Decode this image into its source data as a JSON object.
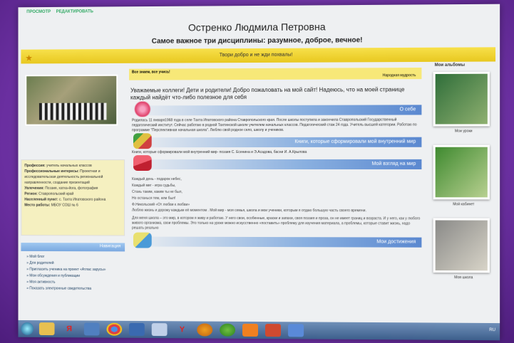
{
  "nav": {
    "items": [
      "ПРОСМОТР",
      "РЕДАКТИРОВАТЬ"
    ]
  },
  "site": {
    "title": "Остренко Людмила Петровна",
    "subtitle": "Самое важное три дисциплины: разумное, доброе, вечное!",
    "banner": "Твори добро и не жди похвалы!"
  },
  "quote": {
    "text": "Все знаем, все учись!",
    "source": "Народная мудрость"
  },
  "welcome": "Уважаемые коллеги! Дети и родители! Добро пожаловать на мой сайт! Надеюсь, что на моей странице каждый найдёт что-либо полезное для себя",
  "sections": [
    {
      "title": "О себе",
      "text": "Родилась 11 января1968 года в селе Тахта Ипатовского района Ставропольского края. После школы поступила и закончила Ставропольский Государственный педагогический институт. Сейчас работаю в родной Тахтинской школе учителем начальных классов. Педагогический стаж 24 года. Учитель высшей категории. Работаю по программе \"Перспективная начальная школа\". Люблю свой родное село, школу и учеников.",
      "icon": "flower-icon",
      "icon_color": "#e0406a"
    },
    {
      "title": "Книги, которые сформировали мой внутренний мир",
      "text": "Книги, которые сформировали мой внутренний мир- поэзия С. Есенина и Э.Асадова, басни И. А.Крылова",
      "icon": "books-icon",
      "icon_color": "#40a040"
    },
    {
      "title": "Мой взгляд на мир",
      "text": "",
      "icon": "paint-roller-icon",
      "icon_color": "#d03040"
    }
  ],
  "poem": [
    "Каждый день - подарок небес,",
    "Каждый миг - игра судьбы,",
    "Стань таким, каким ты не был,",
    "Но останься тем, кем был!",
    "Ф.Никольский «От любви к любви»",
    "Люблю жизнь и дорожу каждым её моментом . Мой мир - моя семья, школа и мои ученики, которым я отдаю большую часть своего времени.",
    "Для меня школа – это мир, в котором я живу и работаю. У него свои, особенные, краски и запахи, своя поэзия и проза, он не имеет границ и возраста. И у него, как у любого живого организма, свои проблемы. Это только на уроке можно искусственно «поставить» проблему для изучения материала, а проблемы, которые ставит жизнь, надо решать реально"
  ],
  "last_section": {
    "title": "Мои достижения"
  },
  "profile": {
    "lines": [
      {
        "label": "Профессия:",
        "value": "учитель начальных классов"
      },
      {
        "label": "Профессиональные интересы:",
        "value": "Проектная и исследовательская деятельность региональной направленности, создание презентаций"
      },
      {
        "label": "Увлечения:",
        "value": "Поэзия, хатха-йога, фотография"
      },
      {
        "label": "Регион:",
        "value": "Ставропольский край"
      },
      {
        "label": "Населенный пункт:",
        "value": "с. Тахта Ипатовского района"
      },
      {
        "label": "Место работы:",
        "value": "МБОУ СОШ № 6"
      }
    ]
  },
  "navigation": {
    "title": "Навигация",
    "items": [
      "Мой блог",
      "Для родителей",
      "Пригласить ученика на проект «Атлас зарусы»",
      "Мои обсуждения и публикации",
      "Моя активность",
      "Показать электронные свидетельства"
    ]
  },
  "albums": {
    "title": "Мои альбомы",
    "items": [
      {
        "caption": "Мои уроки",
        "colors": [
          "#2f6e3a",
          "#8fb070"
        ]
      },
      {
        "caption": "Мой кабинет",
        "colors": [
          "#3f8a30",
          "#b8d090"
        ]
      },
      {
        "caption": "Моя школа",
        "colors": [
          "#8a8a88",
          "#d8d4c8"
        ]
      }
    ]
  },
  "taskbar": {
    "buttons": [
      "Я",
      "Y"
    ],
    "tray": "RU"
  }
}
